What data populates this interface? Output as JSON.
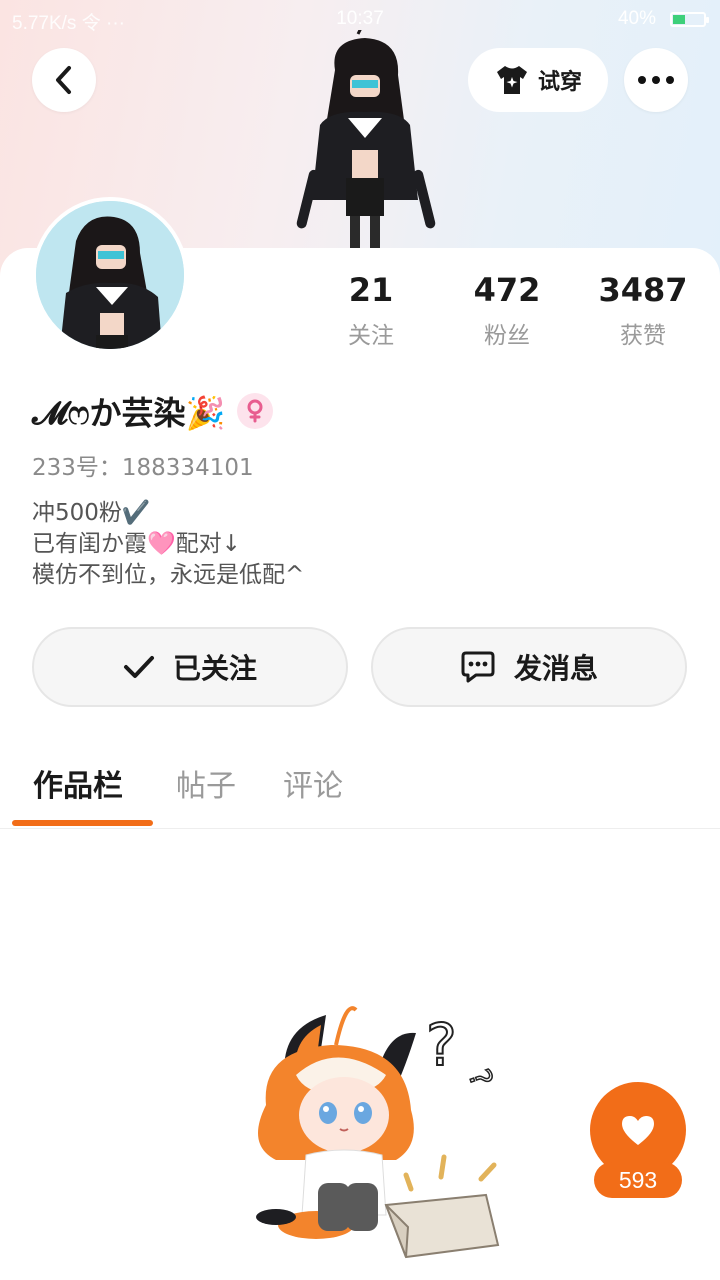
{
  "status_bar": {
    "network": "5.77K/s 令 ···",
    "time": "10:37",
    "battery": "40%"
  },
  "header": {
    "try_on_label": "试穿",
    "icons": {
      "back": "chevron-left-icon",
      "try_on": "tshirt-sparkle-icon",
      "more": "more-dots-icon"
    }
  },
  "profile": {
    "stats": [
      {
        "value": "21",
        "label": "关注"
      },
      {
        "value": "472",
        "label": "粉丝"
      },
      {
        "value": "3487",
        "label": "获赞"
      }
    ],
    "username": "𝓜ෆか芸染🎉",
    "gender": "female",
    "uid": "233号：188334101",
    "bio": [
      "冲500粉✔️",
      "已有闺か霞🩷配对↓",
      "模仿不到位，永远是低配^"
    ]
  },
  "actions": {
    "follow_label": "已关注",
    "message_label": "发消息"
  },
  "tabs": [
    {
      "label": "作品栏",
      "active": true
    },
    {
      "label": "帖子",
      "active": false
    },
    {
      "label": "评论",
      "active": false
    }
  ],
  "like_badge": {
    "count": "593"
  },
  "colors": {
    "accent": "#f26d18",
    "gender_pink": "#e85d8f"
  }
}
